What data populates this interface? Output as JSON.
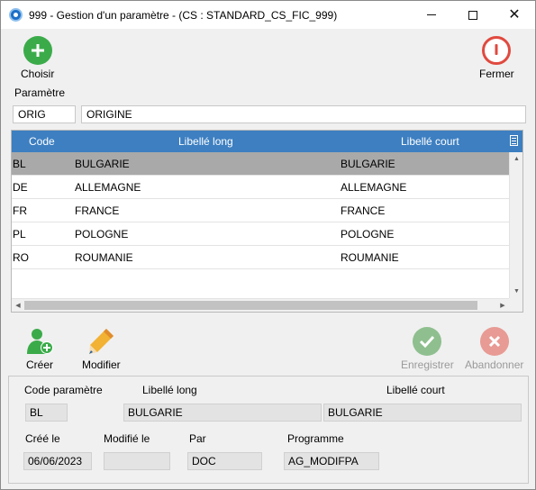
{
  "window": {
    "title": "999 - Gestion d'un paramètre - (CS : STANDARD_CS_FIC_999)",
    "minimize_glyph": "—",
    "maximize_glyph": "☐",
    "close_glyph": "✕"
  },
  "toolbar": {
    "choisir_label": "Choisir",
    "choisir_icon": "plus-icon",
    "fermer_label": "Fermer",
    "fermer_icon": "power-icon"
  },
  "parametre": {
    "section_label": "Paramètre",
    "code_value": "ORIG",
    "libelle_value": "ORIGINE"
  },
  "grid": {
    "headers": {
      "code": "Code",
      "libelle_long": "Libellé long",
      "libelle_court": "Libellé court"
    },
    "rows": [
      {
        "code": "BL",
        "libelle_long": "BULGARIE",
        "libelle_court": "BULGARIE"
      },
      {
        "code": "DE",
        "libelle_long": "ALLEMAGNE",
        "libelle_court": "ALLEMAGNE"
      },
      {
        "code": "FR",
        "libelle_long": "FRANCE",
        "libelle_court": "FRANCE"
      },
      {
        "code": "PL",
        "libelle_long": "POLOGNE",
        "libelle_court": "POLOGNE"
      },
      {
        "code": "RO",
        "libelle_long": "ROUMANIE",
        "libelle_court": "ROUMANIE"
      }
    ],
    "selected_row": 0
  },
  "actions": {
    "creer_label": "Créer",
    "modifier_label": "Modifier",
    "enregistrer_label": "Enregistrer",
    "abandonner_label": "Abandonner"
  },
  "detail": {
    "code_parametre_label": "Code paramètre",
    "libelle_long_label": "Libellé long",
    "libelle_court_label": "Libellé court",
    "code_value": "BL",
    "libelle_long_value": "BULGARIE",
    "libelle_court_value": "BULGARIE",
    "cree_le_label": "Créé le",
    "modifie_le_label": "Modifié le",
    "par_label": "Par",
    "programme_label": "Programme",
    "cree_le_value": "06/06/2023",
    "modifie_le_value": "",
    "par_value": "DOC",
    "programme_value": "AG_MODIFPA"
  },
  "colors": {
    "accent_header": "#3d7fc1",
    "choisir_green": "#3bab4a",
    "fermer_red": "#e04a3f",
    "disabled_green": "#8fbf8f",
    "disabled_red": "#e89a94"
  }
}
